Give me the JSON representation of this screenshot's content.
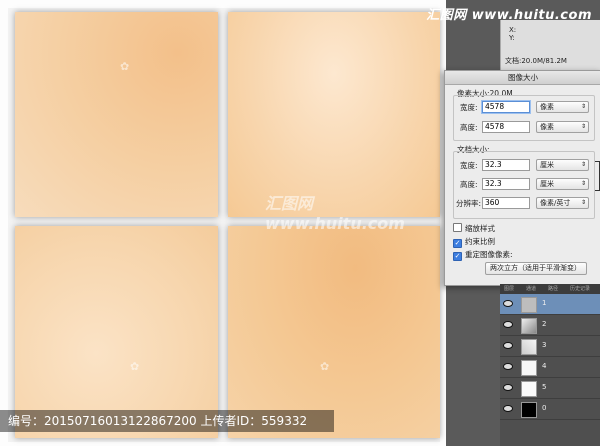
{
  "brand": "汇图网 www.huitu.com",
  "info_panel": {
    "xy": "X:\nY:",
    "doc_size": "文档:20.0M/81.2M"
  },
  "dialog": {
    "title": "图像大小",
    "pixel_dimensions": {
      "title": "像素大小:20.0M",
      "width_label": "宽度:",
      "width_value": "4578",
      "width_unit": "像素",
      "height_label": "高度:",
      "height_value": "4578",
      "height_unit": "像素"
    },
    "document_size": {
      "title": "文档大小:",
      "width_label": "宽度:",
      "width_value": "32.3",
      "width_unit": "厘米",
      "height_label": "高度:",
      "height_value": "32.3",
      "height_unit": "厘米",
      "resolution_label": "分辨率:",
      "resolution_value": "360",
      "resolution_unit": "像素/英寸"
    },
    "scale_styles": {
      "label": "缩放样式",
      "checked": false
    },
    "constrain_proportions": {
      "label": "约束比例",
      "checked": true
    },
    "resample": {
      "label": "重定图像像素:",
      "checked": true,
      "method": "两次立方（适用于平滑渐变）"
    }
  },
  "layers": {
    "tabs": [
      "图层",
      "通道",
      "路径",
      "历史记录"
    ],
    "rows": [
      {
        "name": "1",
        "selected": true
      },
      {
        "name": "2",
        "selected": false
      },
      {
        "name": "3",
        "selected": false
      },
      {
        "name": "4",
        "selected": false
      },
      {
        "name": "5",
        "selected": false
      },
      {
        "name": "0",
        "selected": false
      }
    ]
  },
  "watermark": {
    "text": "编号：20150716013122867200 上传者ID：559332",
    "logo": "汇图网 www.huitu.com"
  }
}
